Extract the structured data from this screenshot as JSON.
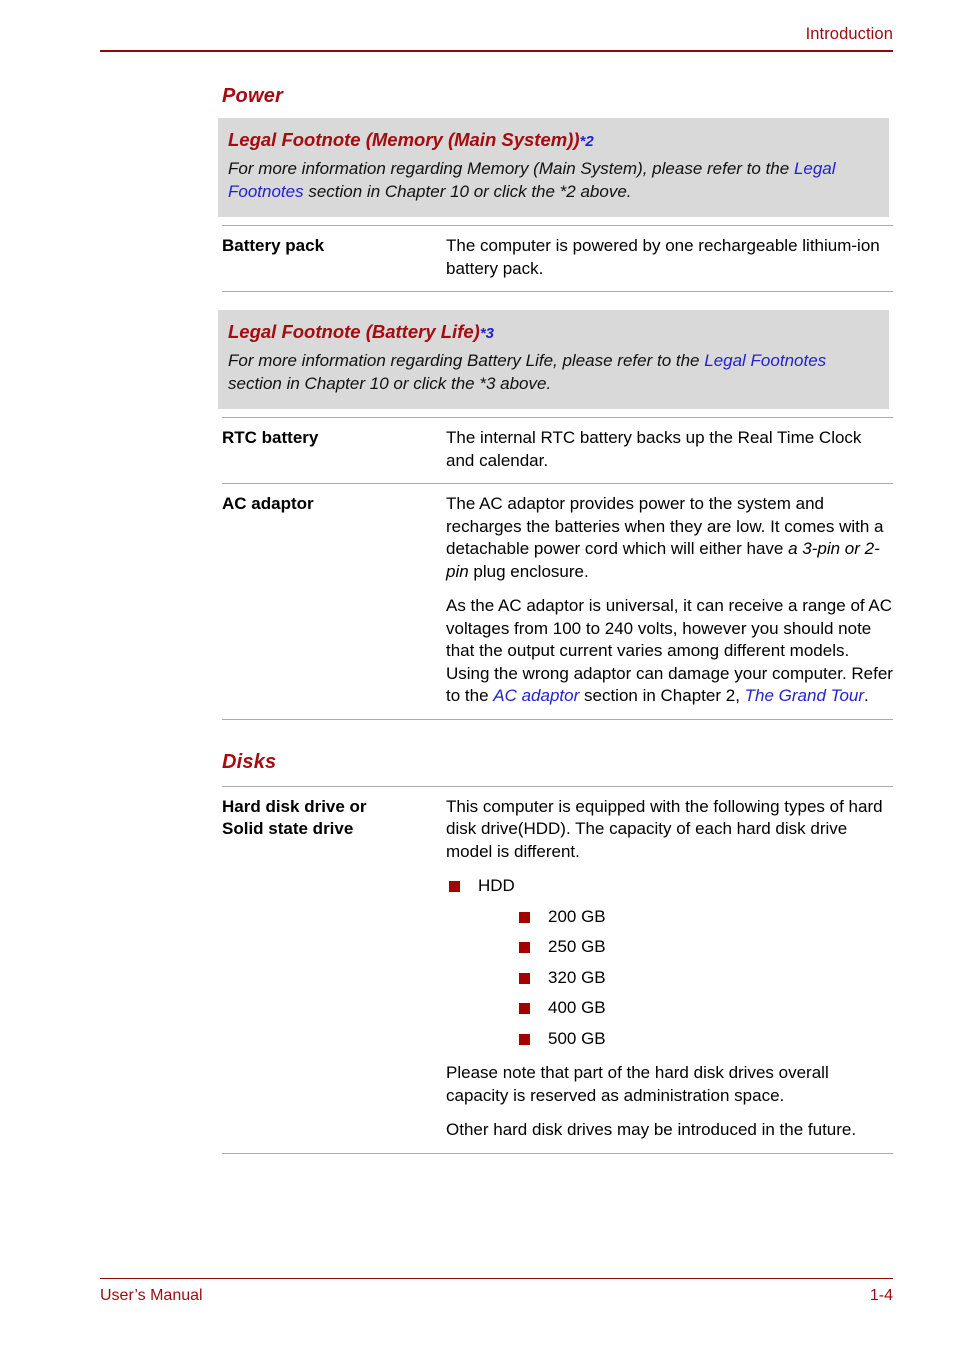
{
  "header": {
    "title": "Introduction"
  },
  "footer": {
    "left": "User’s Manual",
    "right": "1-4"
  },
  "sections": {
    "power": {
      "heading": "Power",
      "memory_footnote": {
        "title": "Legal Footnote (Memory (Main System))",
        "marker": "*2",
        "body_1": "For more information regarding Memory (Main System), please refer to the ",
        "link": "Legal Footnotes",
        "body_2": " section in Chapter 10 or click the *2 above."
      },
      "battery_pack": {
        "label": "Battery pack",
        "desc": "The computer is powered by one rechargeable lithium-ion battery pack."
      },
      "battery_footnote": {
        "title": "Legal Footnote (Battery Life)",
        "marker": "*3",
        "body_1": "For more information regarding Battery Life, please refer to the ",
        "link": "Legal Footnotes",
        "body_2": " section in Chapter 10 or click the *3 above."
      },
      "rtc_battery": {
        "label": "RTC battery",
        "desc": "The internal RTC battery backs up the Real Time Clock and calendar."
      },
      "ac_adaptor": {
        "label": "AC adaptor",
        "para1_a": "The AC adaptor provides power to the system and recharges the batteries when they are low. It comes with a detachable power cord which will either have ",
        "para1_em": "a 3-pin or 2-pin",
        "para1_b": " plug enclosure.",
        "para2_a": "As the AC adaptor is universal, it can receive a range of AC voltages from 100 to 240 volts, however you should note that the output current varies among different models. Using the wrong adaptor can damage your computer. Refer to the ",
        "para2_link1": "AC adaptor",
        "para2_b": " section in Chapter 2, ",
        "para2_link2": "The Grand Tour",
        "para2_c": "."
      }
    },
    "disks": {
      "heading": "Disks",
      "hard_disk": {
        "label_line1": "Hard disk drive or",
        "label_line2": "Solid state drive",
        "intro": "This computer is equipped with the following types of hard disk drive(HDD). The capacity of each hard disk drive model is different.",
        "bullet_hdd": "HDD",
        "capacities": [
          "200 GB",
          "250 GB",
          "320 GB",
          "400 GB",
          "500 GB"
        ],
        "note1": "Please note that part of the hard disk drives overall capacity is reserved as administration space.",
        "note2": "Other hard disk drives may be introduced in the future."
      }
    }
  },
  "colors": {
    "heading_red": "#A50B10",
    "rule_red": "#8C0A0C",
    "link_blue": "#2222CC",
    "callout_gray": "#D9D9D9",
    "bullet_red": "#A30000"
  }
}
